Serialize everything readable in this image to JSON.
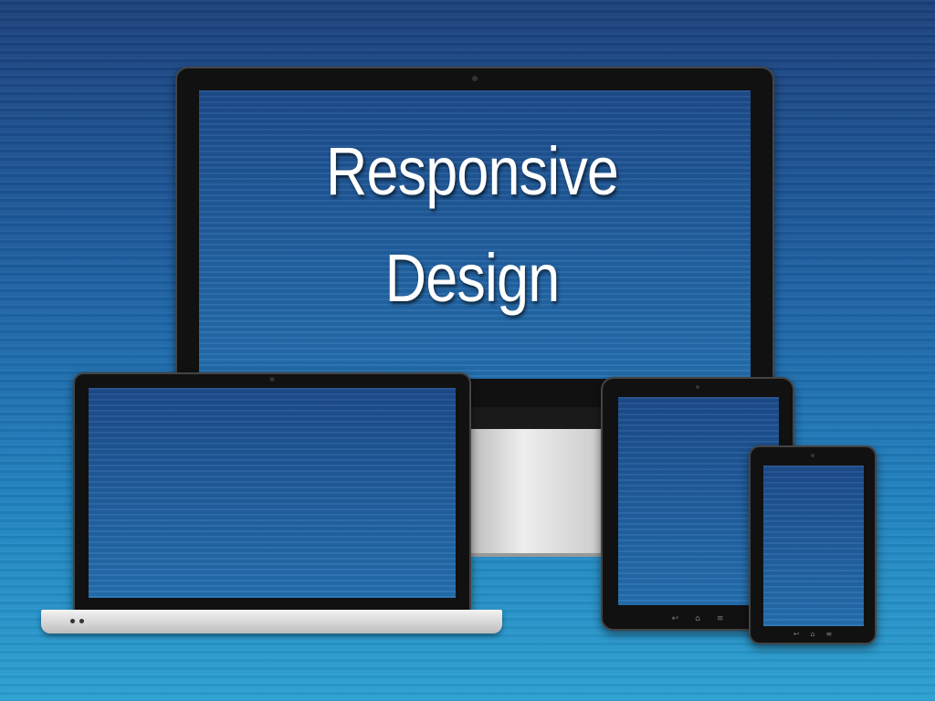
{
  "headline": {
    "line1": "Responsive",
    "line2": "Design"
  },
  "colors": {
    "ocean_top": "#1a3f7a",
    "ocean_bottom": "#2a9fcf",
    "bezel": "#111111",
    "text": "#ffffff"
  },
  "icons": [
    "back-icon",
    "home-icon",
    "menu-icon"
  ]
}
